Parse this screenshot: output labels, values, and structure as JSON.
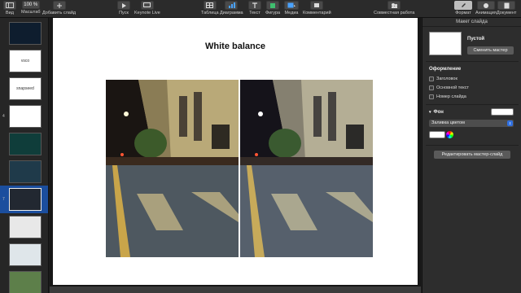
{
  "toolbar": {
    "view": "Вид",
    "zoom_label": "Масштаб",
    "zoom_value": "100 %",
    "add_slide": "Добавить слайд",
    "play": "Пуск",
    "keynote_live": "Keynote Live",
    "table": "Таблица",
    "chart": "Диаграмма",
    "text": "Текст",
    "shape": "Фигура",
    "media": "Медиа",
    "comment": "Комментарий",
    "collaborate": "Совместная работа",
    "format": "Формат",
    "animate": "Анимация",
    "document": "Документ"
  },
  "navigator": {
    "slides": [
      {
        "num": "",
        "label": "",
        "bg": "#0e1d2e"
      },
      {
        "num": "",
        "label": "vsco",
        "bg": "#ffffff"
      },
      {
        "num": "",
        "label": "snapseed",
        "bg": "#ffffff"
      },
      {
        "num": "4",
        "label": "",
        "bg": "#ffffff"
      },
      {
        "num": "",
        "label": "",
        "bg": "#0f3d3a"
      },
      {
        "num": "",
        "label": "",
        "bg": "#1f3a4a"
      },
      {
        "num": "7",
        "label": "",
        "bg": "#222831"
      },
      {
        "num": "",
        "label": "",
        "bg": "#e8e8e8"
      },
      {
        "num": "",
        "label": "",
        "bg": "#dfe6ea"
      },
      {
        "num": "",
        "label": "",
        "bg": "#5d7f4a"
      }
    ],
    "selected_index": 6
  },
  "slide": {
    "title": "White balance"
  },
  "inspector": {
    "header": "Макет слайда",
    "master_name": "Пустой",
    "change_master": "Сменить мастер",
    "appearance_title": "Оформление",
    "checks": [
      "Заголовок",
      "Основной текст",
      "Номер слайда"
    ],
    "background_title": "Фон",
    "fill_type": "Заливка цветом",
    "edit_master": "Редактировать мастер-слайд"
  },
  "colors": {
    "selection": "#1b4e9e",
    "accent": "#2f6fe0"
  }
}
